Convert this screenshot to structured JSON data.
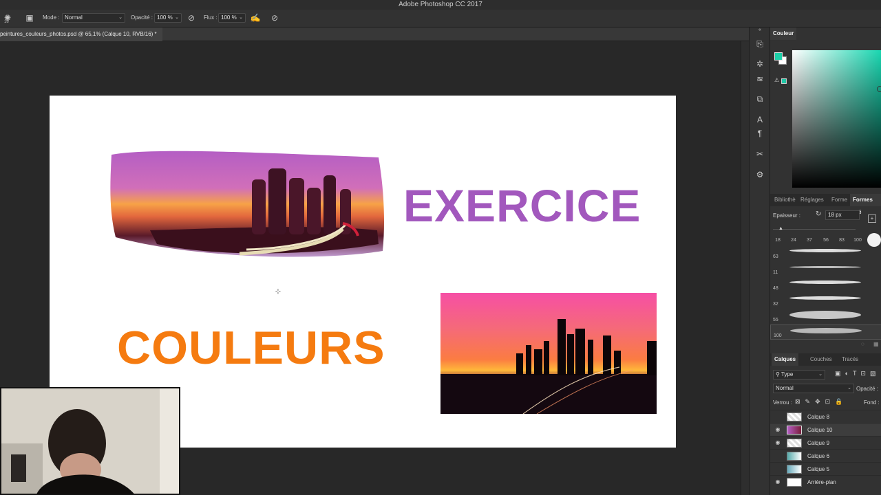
{
  "app": {
    "title": "Adobe Photoshop CC 2017"
  },
  "options_bar": {
    "brush_size": "18",
    "mode_label": "Mode :",
    "mode_value": "Normal",
    "opacity_label": "Opacité :",
    "opacity_value": "100 %",
    "flow_label": "Flux :",
    "flow_value": "100 %"
  },
  "document": {
    "tab_title": "peintures_couleurs_photos.psd @ 65,1% (Calque 10, RVB/16) *",
    "canvas": {
      "headline_top": "EXERCICE",
      "headline_bottom": "COULEURS"
    }
  },
  "color_panel": {
    "title": "Couleur",
    "foreground": "#1ed1a9",
    "background": "#ffffff",
    "hue": "#18d6b0"
  },
  "brush_panel": {
    "tabs": [
      "Bibliothè",
      "Réglages",
      "Forme",
      "Formes pré"
    ],
    "thickness_label": "Epaisseur :",
    "thickness_value": "18 px",
    "sizes": [
      "18",
      "24",
      "37",
      "56",
      "83",
      "100"
    ],
    "strokes": [
      {
        "num": "63"
      },
      {
        "num": "11"
      },
      {
        "num": "48"
      },
      {
        "num": "32"
      },
      {
        "num": "55"
      },
      {
        "num": "100"
      }
    ]
  },
  "layers_panel": {
    "tabs": [
      "Calques",
      "Couches",
      "Tracés"
    ],
    "filter_value": "Type",
    "blend_mode": "Normal",
    "opacity_label": "Opacité :",
    "lock_label": "Verrou :",
    "fill_label": "Fond :",
    "layers": [
      {
        "name": "Calque 8",
        "visible": false,
        "active": false
      },
      {
        "name": "Calque 10",
        "visible": true,
        "active": true
      },
      {
        "name": "Calque 9",
        "visible": true,
        "active": false
      },
      {
        "name": "Calque 6",
        "visible": false,
        "active": false
      },
      {
        "name": "Calque 5",
        "visible": false,
        "active": false
      },
      {
        "name": "Arrière-plan",
        "visible": true,
        "active": false
      }
    ]
  }
}
